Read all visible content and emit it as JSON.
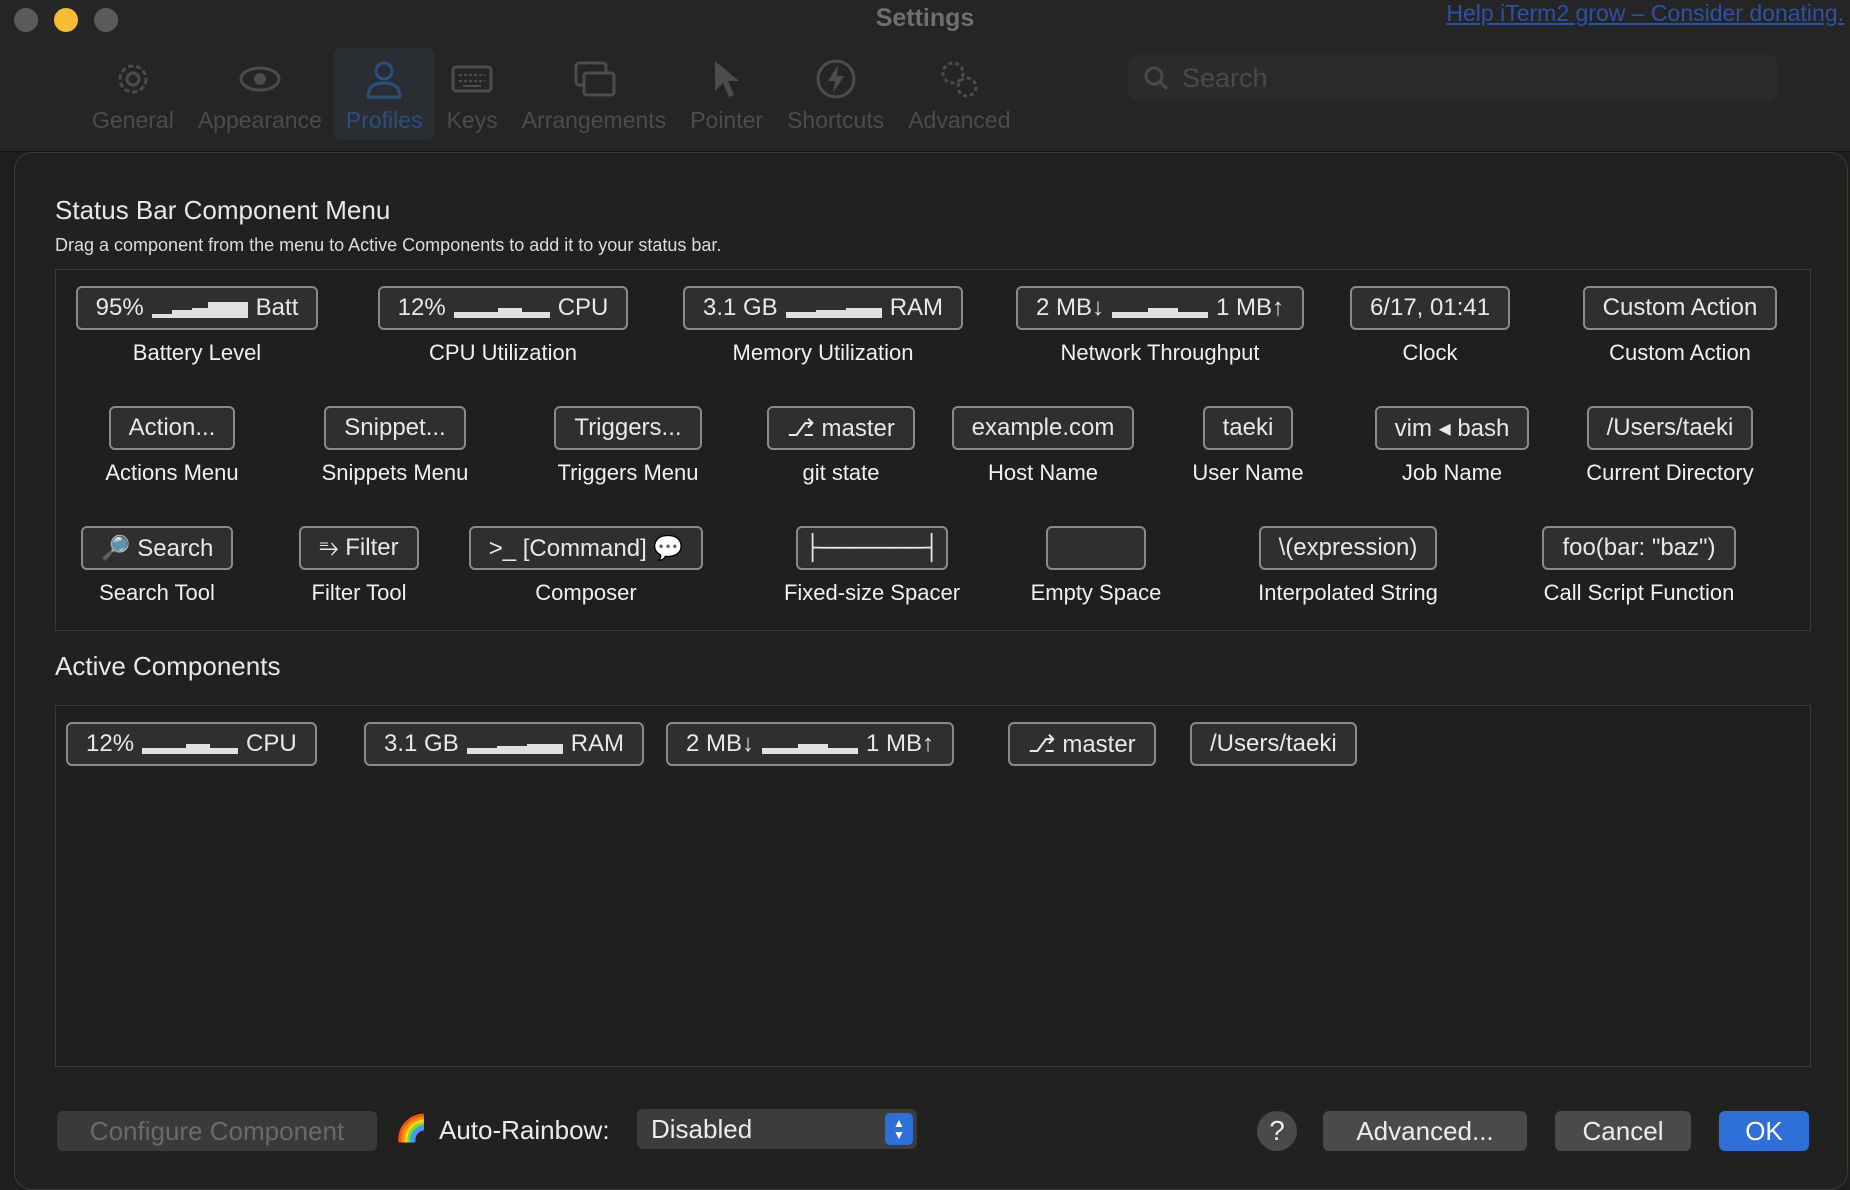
{
  "window": {
    "title": "Settings",
    "donate_link": "Help iTerm2 grow – Consider donating."
  },
  "toolbar": {
    "items": [
      {
        "label": "General",
        "icon": "gear-icon"
      },
      {
        "label": "Appearance",
        "icon": "eye-icon"
      },
      {
        "label": "Profiles",
        "icon": "person-icon",
        "active": true
      },
      {
        "label": "Keys",
        "icon": "keyboard-icon"
      },
      {
        "label": "Arrangements",
        "icon": "windows-icon"
      },
      {
        "label": "Pointer",
        "icon": "pointer-icon"
      },
      {
        "label": "Shortcuts",
        "icon": "lightning-icon"
      },
      {
        "label": "Advanced",
        "icon": "gears-icon"
      }
    ],
    "search_placeholder": "Search"
  },
  "menu": {
    "title": "Status Bar Component Menu",
    "subtitle": "Drag a component from the menu to Active Components to add it to your status bar.",
    "components": [
      {
        "pill_left": "95%",
        "pill_right": "Batt",
        "spark": true,
        "label": "Battery Level"
      },
      {
        "pill_left": "12%",
        "pill_right": "CPU",
        "spark": true,
        "label": "CPU Utilization"
      },
      {
        "pill_left": "3.1 GB",
        "pill_right": "RAM",
        "spark": true,
        "label": "Memory Utilization"
      },
      {
        "pill_left": "2 MB↓",
        "pill_right": "1 MB↑",
        "spark": true,
        "label": "Network Throughput"
      },
      {
        "pill": "6/17, 01:41",
        "label": "Clock"
      },
      {
        "pill": "Custom Action",
        "label": "Custom Action"
      },
      {
        "pill": "Action...",
        "label": "Actions Menu"
      },
      {
        "pill": "Snippet...",
        "label": "Snippets Menu"
      },
      {
        "pill": "Triggers...",
        "label": "Triggers Menu"
      },
      {
        "pill": "⎇ master",
        "label": "git state"
      },
      {
        "pill": "example.com",
        "label": "Host Name"
      },
      {
        "pill": "taeki",
        "label": "User Name"
      },
      {
        "pill": "vim ◂ bash",
        "label": "Job Name"
      },
      {
        "pill": "/Users/taeki",
        "label": "Current Directory"
      },
      {
        "pill": "🔎 Search",
        "label": "Search Tool"
      },
      {
        "pill": "⥱ Filter",
        "label": "Filter Tool"
      },
      {
        "pill": ">_ [Command] 💬",
        "label": "Composer"
      },
      {
        "pill": "├──────┤",
        "label": "Fixed-size Spacer"
      },
      {
        "pill": "",
        "label": "Empty Space"
      },
      {
        "pill": "\\(expression)",
        "label": "Interpolated String"
      },
      {
        "pill": "foo(bar: \"baz\")",
        "label": "Call Script Function"
      }
    ]
  },
  "active": {
    "title": "Active Components",
    "components": [
      {
        "pill_left": "12%",
        "pill_right": "CPU",
        "spark": true
      },
      {
        "pill_left": "3.1 GB",
        "pill_right": "RAM",
        "spark": true
      },
      {
        "pill_left": "2 MB↓",
        "pill_right": "1 MB↑",
        "spark": true
      },
      {
        "pill": "⎇ master"
      },
      {
        "pill": "/Users/taeki"
      }
    ]
  },
  "footer": {
    "configure_label": "Configure Component",
    "rainbow_icon": "🌈",
    "auto_rainbow_label": "Auto-Rainbow:",
    "auto_rainbow_value": "Disabled",
    "help_label": "?",
    "advanced_label": "Advanced...",
    "cancel_label": "Cancel",
    "ok_label": "OK"
  },
  "colors": {
    "accent": "#2f6fd8",
    "background": "#212120",
    "traffic_minimize": "#f5bd2f"
  }
}
